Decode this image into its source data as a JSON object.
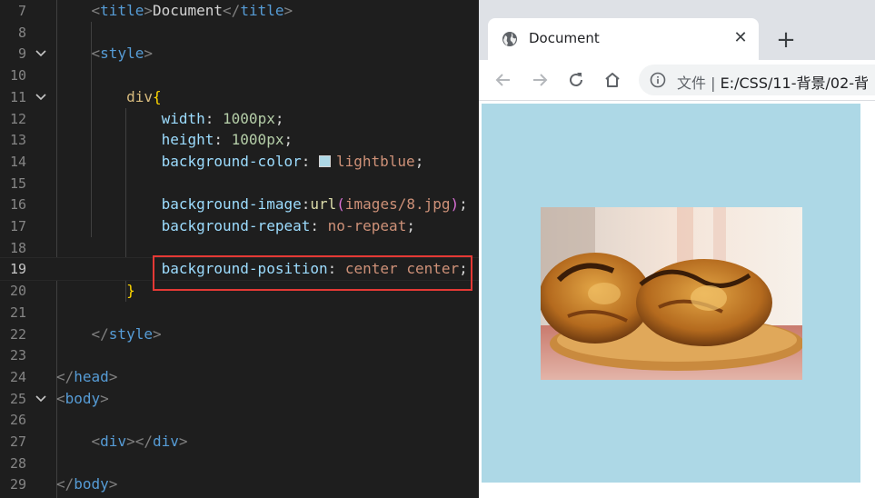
{
  "editor": {
    "lines": [
      {
        "n": "7",
        "html": "    <span class=\"t-brk\">&lt;</span><span class=\"t-tag\">title</span><span class=\"t-brk\">&gt;</span><span class=\"t-txt\">Document</span><span class=\"t-brk\">&lt;/</span><span class=\"t-tag\">title</span><span class=\"t-brk\">&gt;</span>"
      },
      {
        "n": "8",
        "html": ""
      },
      {
        "n": "9",
        "fold": true,
        "html": "    <span class=\"t-brk\">&lt;</span><span class=\"t-tag\">style</span><span class=\"t-brk\">&gt;</span>"
      },
      {
        "n": "10",
        "html": ""
      },
      {
        "n": "11",
        "fold": true,
        "html": "        <span class=\"t-sel\">div</span><span class=\"t-brace\">{</span>"
      },
      {
        "n": "12",
        "html": "            <span class=\"t-prop\">width</span>: <span class=\"t-num\">1000px</span>;"
      },
      {
        "n": "13",
        "html": "            <span class=\"t-prop\">height</span>: <span class=\"t-num\">1000px</span>;"
      },
      {
        "n": "14",
        "html": "            <span class=\"t-prop\">background-color</span>: <span class=\"swatch\" style=\"background:#add8e6\"></span><span class=\"t-val\">lightblue</span>;"
      },
      {
        "n": "15",
        "html": ""
      },
      {
        "n": "16",
        "html": "            <span class=\"t-prop\">background-image</span>:<span class=\"t-fn\">url</span><span class=\"t-brace2\">(</span><span class=\"t-val\">images/8.jpg</span><span class=\"t-brace2\">)</span>;"
      },
      {
        "n": "17",
        "html": "            <span class=\"t-prop\">background-repeat</span>: <span class=\"t-val\">no-repeat</span>;"
      },
      {
        "n": "18",
        "html": ""
      },
      {
        "n": "19",
        "active": true,
        "html": "            <span class=\"t-prop\">background-position</span>: <span class=\"t-val\">center center</span>;"
      },
      {
        "n": "20",
        "html": "        <span class=\"t-brace\">}</span>"
      },
      {
        "n": "21",
        "html": ""
      },
      {
        "n": "22",
        "html": "    <span class=\"t-brk\">&lt;/</span><span class=\"t-tag\">style</span><span class=\"t-brk\">&gt;</span>"
      },
      {
        "n": "23",
        "html": ""
      },
      {
        "n": "24",
        "html": "<span class=\"t-brk\">&lt;/</span><span class=\"t-tag\">head</span><span class=\"t-brk\">&gt;</span>"
      },
      {
        "n": "25",
        "fold": true,
        "html": "<span class=\"t-brk\">&lt;</span><span class=\"t-tag\">body</span><span class=\"t-brk\">&gt;</span>"
      },
      {
        "n": "26",
        "html": ""
      },
      {
        "n": "27",
        "html": "    <span class=\"t-brk\">&lt;</span><span class=\"t-tag\">div</span><span class=\"t-brk\">&gt;&lt;/</span><span class=\"t-tag\">div</span><span class=\"t-brk\">&gt;</span>"
      },
      {
        "n": "28",
        "html": ""
      },
      {
        "n": "29",
        "html": "<span class=\"t-brk\">&lt;/</span><span class=\"t-tag\">body</span><span class=\"t-brk\">&gt;</span>"
      }
    ]
  },
  "browser": {
    "tab_title": "Document",
    "tab_close": "✕",
    "new_tab": "+",
    "url_scheme": "文件",
    "url_sep": "|",
    "url_path": "E:/CSS/11-背景/02-背",
    "page_bg_color": "#add8e6"
  }
}
